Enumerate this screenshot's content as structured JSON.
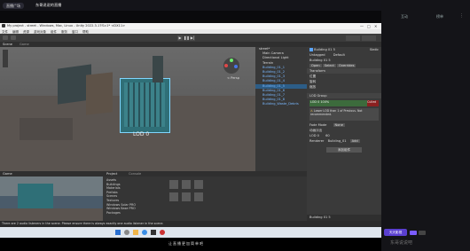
{
  "stream": {
    "broadcast_label": "直播广场",
    "title": "东哥说说的直播"
  },
  "unity": {
    "window_title": "My project - street - Windows, Mac, Linux - Unity 2022.3.17f1c1* <DX11>",
    "menu": [
      "文件",
      "编辑",
      "资源",
      "游戏对象",
      "组件",
      "服务",
      "窗口",
      "帮助"
    ],
    "scene_tabs": [
      "Scene",
      "Game"
    ],
    "scene_overlay_label": "LOD 0",
    "persp_label": "< Persp"
  },
  "hierarchy": {
    "root": "street*",
    "items": [
      "Main Camera",
      "Directional Light",
      "Terrain",
      "Building_01_1",
      "Building_01_2",
      "Building_01_3",
      "Building_01_4",
      "Building_01_5",
      "Building_01_6",
      "Building_01_7",
      "Building_01_8",
      "Building_Waste_Debris"
    ]
  },
  "inspector": {
    "object_name": "Building 01 5",
    "tag_label": "Untagged",
    "layer_label": "Default",
    "static_label": "Static",
    "prefab_label": "Building 01 5",
    "prefab_buttons": [
      "Open",
      "Select",
      "Overrides"
    ],
    "transform_title": "Transform",
    "transform_rows": [
      "位置",
      "旋转",
      "缩放"
    ],
    "lod_title": "LOD Group",
    "lod_label": "LOD 0",
    "culled_label": "Culled",
    "lod_percent": "100%",
    "warning": "Lower LOD than 1 of Previous. Not recommended.",
    "fade_label": "Fade Mode",
    "fade_value": "None",
    "animate_label": "动画淡出",
    "lod0_label": "LOD 0",
    "transition_value": "60",
    "renderers": [
      "Renderer",
      "Building_01",
      "Add"
    ],
    "add_component_label": "添加组件",
    "footer_name": "Building 01 5"
  },
  "bottom": {
    "tabs": [
      "Project",
      "Console"
    ],
    "game_tab": "Game",
    "project_items": [
      "Assets",
      "Buildings",
      "Materials",
      "Prefabs",
      "Scenes",
      "Textures",
      "Windows Solar PRO",
      "Windows Base PRO",
      "Packages"
    ]
  },
  "status": {
    "message": "There are 2 audio listeners in the scene. Please ensure there is always exactly one audio listener in the scene."
  },
  "caption": {
    "text": "让直播更加简单吧"
  },
  "chat": {
    "tabs": [
      "互动",
      "榜单"
    ],
    "bottom_brand": "天天影视",
    "watermark": "东哥说说吧"
  },
  "colors": {
    "accent_blue": "#2a6fcf",
    "scene_bg": "#5b5b5b",
    "building_teal": "#2f6f77"
  }
}
